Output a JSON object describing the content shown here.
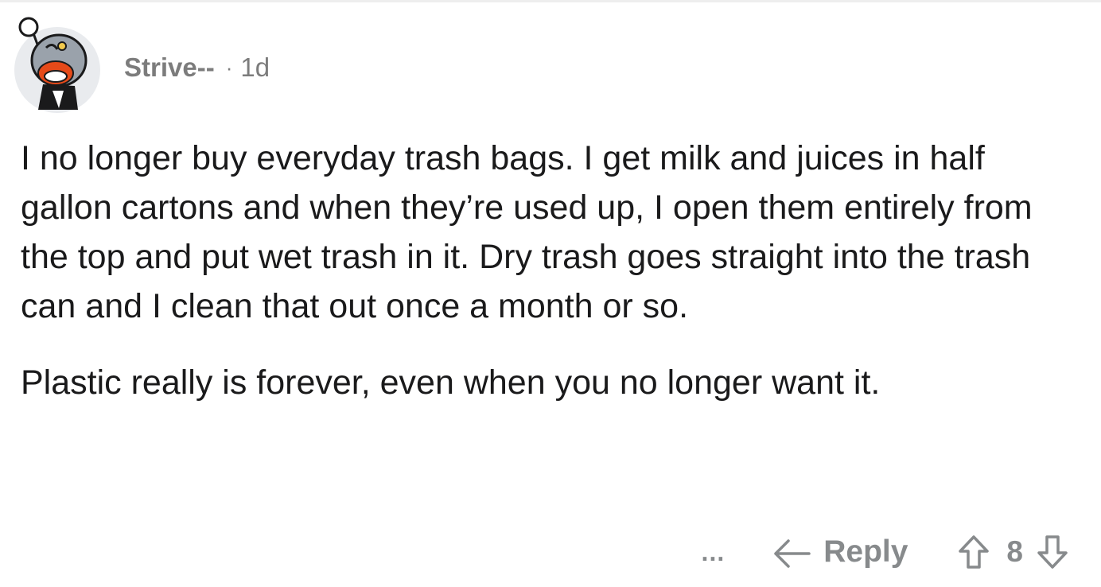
{
  "comment": {
    "author": "Strive--",
    "separator": "·",
    "age": "1d",
    "paragraphs": [
      "I no longer buy everyday trash bags.  I get milk and juices in half gallon cartons and when they’re used up, I open them entirely from the top and put wet trash in it. Dry trash goes straight into the trash can and I clean that out once a month or so.",
      "Plastic really is forever, even when you no longer want it."
    ]
  },
  "actions": {
    "more_label": "...",
    "reply_label": "Reply",
    "vote_count": "8"
  },
  "icons": {
    "avatar": "snoo-avatar",
    "reply": "reply-arrow-icon",
    "upvote": "upvote-arrow-icon",
    "downvote": "downvote-arrow-icon"
  },
  "colors": {
    "text": "#1a1a1b",
    "meta": "#7c7c7c",
    "action": "#878a8c"
  }
}
